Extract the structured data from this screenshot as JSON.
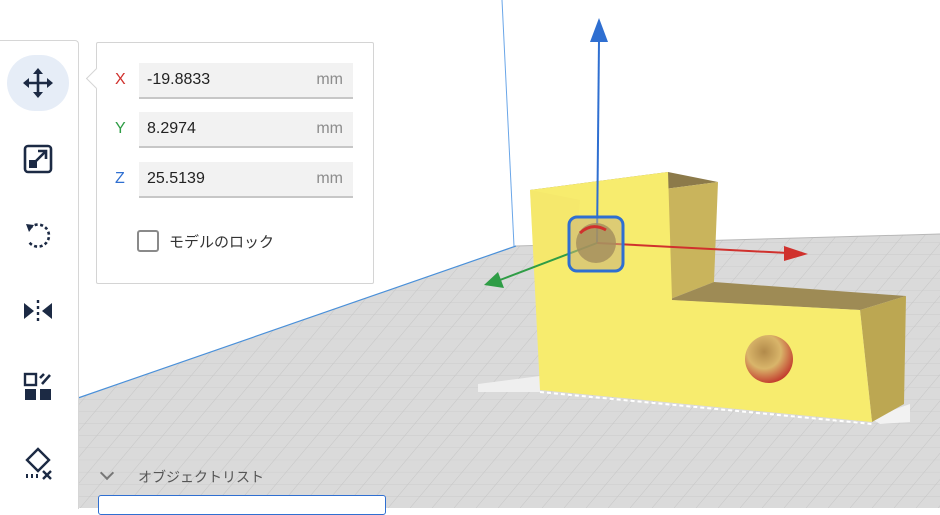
{
  "toolbar": {
    "tools": [
      {
        "name": "move",
        "icon": "move-icon",
        "active": true
      },
      {
        "name": "scale",
        "icon": "scale-icon"
      },
      {
        "name": "rotate",
        "icon": "rotate-icon"
      },
      {
        "name": "mirror",
        "icon": "mirror-icon"
      },
      {
        "name": "per-model-settings",
        "icon": "per-model-settings-icon"
      },
      {
        "name": "support-blocker",
        "icon": "support-blocker-icon"
      }
    ]
  },
  "move_panel": {
    "x": {
      "label": "X",
      "value": "-19.8833",
      "unit": "mm",
      "color": "#d0312d"
    },
    "y": {
      "label": "Y",
      "value": "8.2974",
      "unit": "mm",
      "color": "#2f9d46"
    },
    "z": {
      "label": "Z",
      "value": "25.5139",
      "unit": "mm",
      "color": "#2f6fd1"
    },
    "lock_label": "モデルのロック",
    "lock_checked": false
  },
  "object_list": {
    "title": "オブジェクトリスト"
  },
  "colors": {
    "model": "#f7ec6e",
    "plate": "#d9d9d9",
    "accent": "#2f6fd1"
  }
}
